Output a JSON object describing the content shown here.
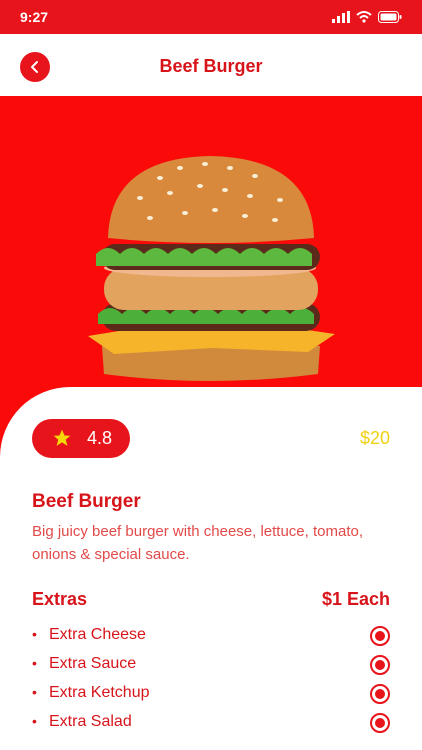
{
  "status_bar": {
    "time": "9:27"
  },
  "header": {
    "title": "Beef Burger"
  },
  "product": {
    "rating": "4.8",
    "price": "$20",
    "name": "Beef Burger",
    "description": "Big juicy beef burger with cheese, lettuce, tomato, onions & special sauce."
  },
  "extras": {
    "title": "Extras",
    "price_label": "$1 Each",
    "items": [
      {
        "label": "Extra Cheese",
        "selected": true
      },
      {
        "label": "Extra Sauce",
        "selected": true
      },
      {
        "label": "Extra Ketchup",
        "selected": true
      },
      {
        "label": "Extra Salad",
        "selected": true
      }
    ]
  },
  "colors": {
    "brand": "#e8141b",
    "hero": "#fb0a0a",
    "price": "#f0d112",
    "text": "#d8141b"
  }
}
